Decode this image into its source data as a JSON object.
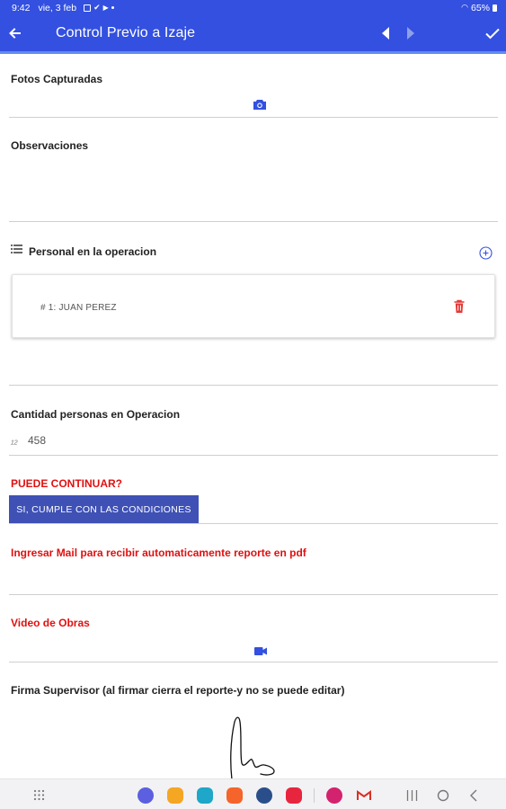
{
  "status_bar": {
    "time": "9:42",
    "date": "vie, 3 feb",
    "battery": "65%"
  },
  "app_bar": {
    "title": "Control Previo a Izaje",
    "back_icon": "arrow-back-icon",
    "prev_icon": "caret-left-icon",
    "next_icon": "caret-right-icon",
    "confirm_icon": "check-icon",
    "color": "#3350e0"
  },
  "form": {
    "fotos": {
      "label": "Fotos Capturadas",
      "icon": "camera-icon"
    },
    "observaciones": {
      "label": "Observaciones"
    },
    "personal": {
      "label": "Personal en la operacion",
      "items": [
        {
          "text": "# 1: JUAN PEREZ"
        }
      ],
      "add_icon": "add-circle-icon",
      "delete_icon": "trash-icon"
    },
    "cantidad": {
      "label": "Cantidad personas en Operacion",
      "value": "458"
    },
    "puede_continuar": {
      "label": "PUEDE CONTINUAR?",
      "option": "SI,  CUMPLE CON LAS CONDICIONES"
    },
    "mail": {
      "label": "Ingresar Mail para recibir automaticamente reporte en pdf"
    },
    "video": {
      "label": "Video de Obras",
      "icon": "video-camera-icon"
    },
    "firma": {
      "label": "Firma Supervisor (al firmar cierra el reporte-y no se puede editar)"
    }
  },
  "colors": {
    "accent": "#3350e0",
    "button": "#3f51b5",
    "required_label": "#e01010",
    "delete": "#e53935"
  },
  "bottom_bar": {
    "apps": [
      "grid-icon",
      "messages-icon",
      "files-icon",
      "notes-icon",
      "contacts-icon",
      "settings-icon",
      "youtube-icon",
      "flower-app-icon",
      "gmail-icon"
    ],
    "system": [
      "recents-icon",
      "home-icon",
      "back-icon"
    ]
  }
}
